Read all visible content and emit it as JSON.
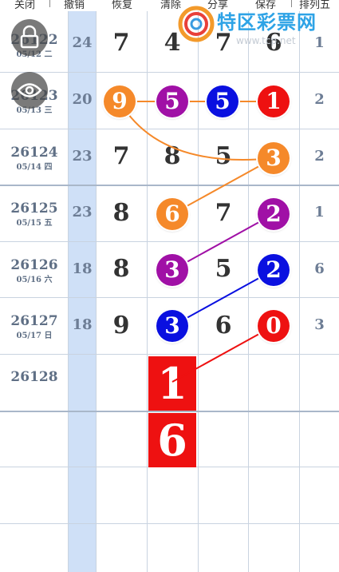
{
  "toolbar": {
    "close": "关闭",
    "undo": "撤销",
    "restore": "恢复",
    "clear": "清除",
    "share": "分享",
    "save": "保存",
    "lottery": "排列五"
  },
  "watermark": {
    "brand": "特区彩票网",
    "url": "www.tcp.net"
  },
  "overlay_icons": [
    "lock-icon",
    "eye-icon"
  ],
  "rows": [
    {
      "period": "26122",
      "date": "05/12 二",
      "sum": "24",
      "digits": [
        "7",
        "4",
        "7",
        "6"
      ],
      "p5": "1"
    },
    {
      "period": "26123",
      "date": "05/13 三",
      "sum": "20",
      "digits": [
        "9",
        "5",
        "5",
        "1"
      ],
      "p5": "2"
    },
    {
      "period": "26124",
      "date": "05/14 四",
      "sum": "23",
      "digits": [
        "7",
        "8",
        "5",
        "3"
      ],
      "p5": "2"
    },
    {
      "period": "26125",
      "date": "05/15 五",
      "sum": "23",
      "digits": [
        "8",
        "6",
        "7",
        "2"
      ],
      "p5": "1"
    },
    {
      "period": "26126",
      "date": "05/16 六",
      "sum": "18",
      "digits": [
        "8",
        "3",
        "5",
        "2"
      ],
      "p5": "6"
    },
    {
      "period": "26127",
      "date": "05/17 日",
      "sum": "18",
      "digits": [
        "9",
        "3",
        "6",
        "0"
      ],
      "p5": "3"
    },
    {
      "period": "26128",
      "date": "",
      "sum": "",
      "digits": [
        "",
        "",
        "",
        ""
      ],
      "p5": ""
    }
  ],
  "picks": [
    "1",
    "6"
  ],
  "colors": {
    "orange": "#f5892a",
    "purple": "#a010a6",
    "blue": "#0a10e0",
    "red": "#ee1111",
    "sum_column": "#cfe0f7"
  }
}
